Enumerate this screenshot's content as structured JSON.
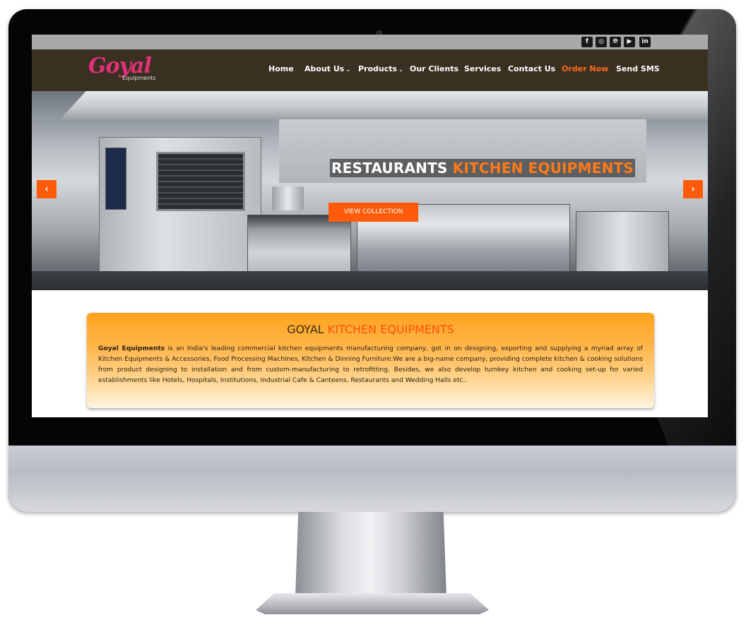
{
  "social_icons": [
    "facebook-icon",
    "instagram-icon",
    "pinterest-icon",
    "youtube-icon",
    "linkedin-icon"
  ],
  "social_glyphs": {
    "facebook": "f",
    "instagram": "◎",
    "pinterest": "℗",
    "youtube": "▶",
    "linkedin": "in"
  },
  "logo": {
    "main": "Goyal",
    "sub": "Equipments"
  },
  "nav": {
    "home": "Home",
    "about": "About Us",
    "products": "Products",
    "clients": "Our Clients",
    "services": "Services",
    "contact": "Contact Us",
    "order": "Order Now",
    "sms": "Send SMS"
  },
  "hero": {
    "headline_white": "RESTAURANTS",
    "headline_orange": "KITCHEN EQUIPMENTS",
    "button": "VIEW COLLECTION",
    "prev": "‹",
    "next": "›"
  },
  "about": {
    "title_dark": "GOYAL",
    "title_orange": "KITCHEN EQUIPMENTS",
    "company": "Goyal Equipments",
    "text": " is an India's leading commercial kitchen equipments manufacturing company, got in on designing, exporting and supplying a myriad array of Kitchen Equipments & Accessories, Food Processing Machines, Kitchen & Dinning Furniture.We are a big-name company, providing complete kitchen & cooking solutions from product designing to installation and from custom-manufacturing to retrofitting. Besides, we also develop turnkey kitchen and cooking set-up for varied establishments like Hotels, Hospitals, Institutions, Industrial Cafe & Canteens, Restaurants and Wedding Halls etc.."
  },
  "colors": {
    "accent": "#ff5b0a",
    "navbar": "#3a3022",
    "topbar": "#a9a9a9"
  }
}
